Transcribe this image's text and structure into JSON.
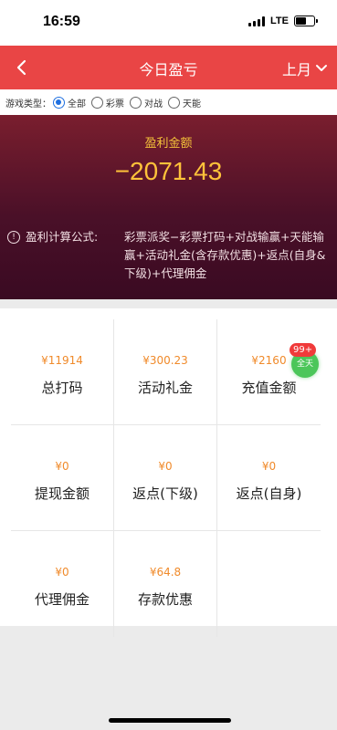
{
  "status": {
    "time": "16:59",
    "network": "LTE"
  },
  "nav": {
    "title": "今日盈亏",
    "period": "上月"
  },
  "filter": {
    "label": "游戏类型：",
    "options": [
      {
        "label": "全部",
        "checked": true
      },
      {
        "label": "彩票",
        "checked": false
      },
      {
        "label": "对战",
        "checked": false
      },
      {
        "label": "天能",
        "checked": false
      }
    ]
  },
  "profit": {
    "label": "盈利金额",
    "value": "−2071.43",
    "formula_label": "盈利计算公式:",
    "formula_text": "彩票派奖−彩票打码+对战输赢+天能输赢+活动礼金(含存款优惠)+返点(自身&下级)+代理佣金"
  },
  "stats": [
    {
      "value": "¥11914",
      "label": "总打码"
    },
    {
      "value": "¥300.23",
      "label": "活动礼金"
    },
    {
      "value": "¥2160",
      "label": "充值金额",
      "badge_count": "99+",
      "badge_text": "全天"
    },
    {
      "value": "¥0",
      "label": "提现金额"
    },
    {
      "value": "¥0",
      "label": "返点(下级)"
    },
    {
      "value": "¥0",
      "label": "返点(自身)"
    },
    {
      "value": "¥0",
      "label": "代理佣金"
    },
    {
      "value": "¥64.8",
      "label": "存款优惠"
    }
  ],
  "colors": {
    "nav": "#e94545",
    "value": "#f08a2a",
    "badge_green": "#4cc65a",
    "badge_red": "#f03a3a",
    "radio_checked": "#1e6fe0"
  }
}
